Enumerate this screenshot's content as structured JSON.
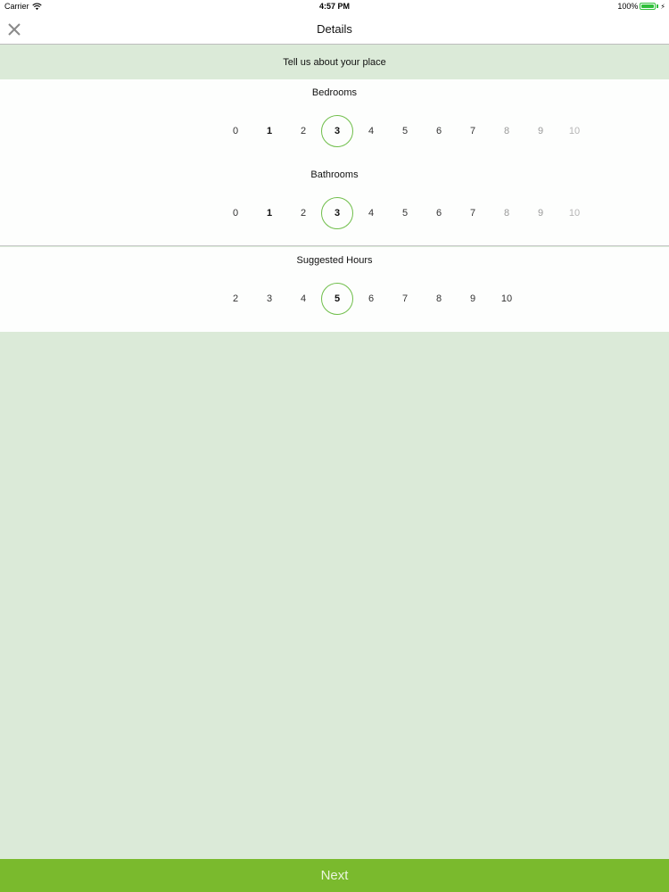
{
  "status_bar": {
    "carrier": "Carrier",
    "time": "4:57 PM",
    "battery": "100%",
    "icons": [
      "wifi-icon",
      "battery-icon",
      "charging-bolt-icon"
    ]
  },
  "nav": {
    "title": "Details",
    "close_icon": "close-icon",
    "progress_fraction": 0.2
  },
  "section_header": "Tell us about your place",
  "pickers": [
    {
      "label": "Bedrooms",
      "options": [
        "0",
        "1",
        "2",
        "3",
        "4",
        "5",
        "6",
        "7",
        "8",
        "9",
        "10"
      ],
      "selected": "3"
    },
    {
      "label": "Bathrooms",
      "options": [
        "0",
        "1",
        "2",
        "3",
        "4",
        "5",
        "6",
        "7",
        "8",
        "9",
        "10"
      ],
      "selected": "3"
    },
    {
      "label": "Suggested Hours",
      "options": [
        "2",
        "3",
        "4",
        "5",
        "6",
        "7",
        "8",
        "9",
        "10"
      ],
      "selected": "5"
    }
  ],
  "next_label": "Next",
  "colors": {
    "accent_green": "#7aba2d",
    "selection_ring": "#6fbe4a",
    "background": "#dbead8",
    "progress": "#8fd3cc"
  }
}
